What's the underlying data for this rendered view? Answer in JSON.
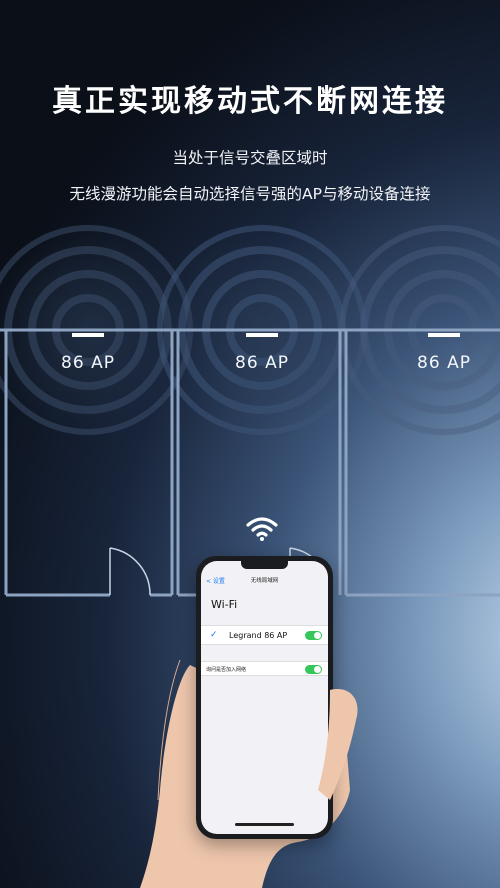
{
  "headline": "真正实现移动式不断网连接",
  "subtitle_line1": "当处于信号交叠区域时",
  "subtitle_line2": "无线漫游功能会自动选择信号强的AP与移动设备连接",
  "ap_labels": [
    "86  AP",
    "86  AP",
    "86  AP"
  ],
  "phone": {
    "back_label": "< 设置",
    "nav_title": "无线局域网",
    "wifi_title": "Wi-Fi",
    "network_name": "Legrand 86 AP",
    "network_connected": true,
    "ask_to_join_label": "询问是否加入网络",
    "ask_to_join_on": true
  },
  "colors": {
    "accent_blue": "#1a7cf0",
    "toggle_green": "#35c759",
    "wall_color": "#8da3c2"
  },
  "icons": [
    "wifi-icon",
    "check-icon",
    "toggle-switch"
  ]
}
